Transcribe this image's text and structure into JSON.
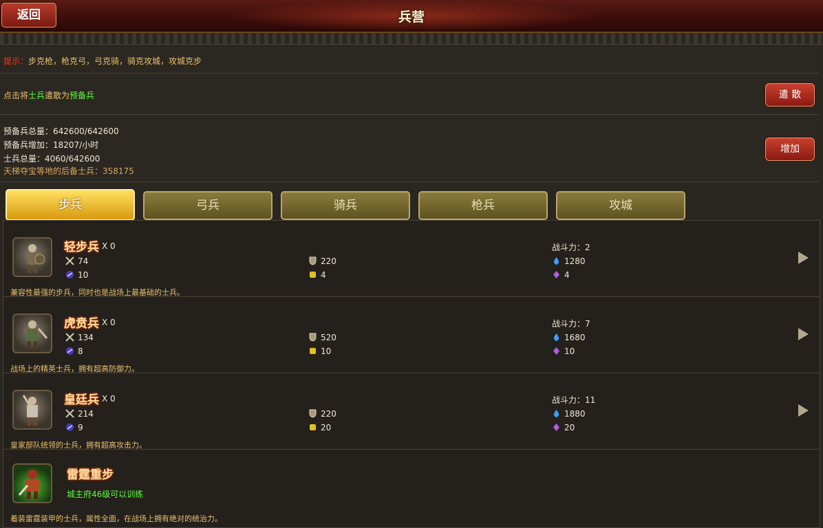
{
  "header": {
    "back_label": "返回",
    "title": "兵营"
  },
  "hint": {
    "prefix": "提示：",
    "text": "步克枪，枪克弓，弓克骑，骑克攻城，攻城克步"
  },
  "dismiss": {
    "text_a": "点击将",
    "text_b": "士兵",
    "text_c": "遣散为",
    "text_d": "预备兵",
    "button_label": "遣 散"
  },
  "stats": {
    "reserve_total": "预备兵总量：642600/642600",
    "reserve_rate": "预备兵增加：18207/小时",
    "soldier_total": "士兵总量：4060/642600",
    "backup": "天梯夺宝等地的后备士兵：358175",
    "add_label": "增加"
  },
  "tabs": [
    {
      "label": "步兵",
      "active": true
    },
    {
      "label": "弓兵",
      "active": false
    },
    {
      "label": "骑兵",
      "active": false
    },
    {
      "label": "枪兵",
      "active": false
    },
    {
      "label": "攻城",
      "active": false
    }
  ],
  "units": [
    {
      "name": "轻步兵",
      "count": "X 0",
      "power": "战斗力：2",
      "attack": "74",
      "defense": "220",
      "hp": "1280",
      "speed": "10",
      "cost": "4",
      "upkeep": "4",
      "desc": "兼容性最强的步兵，同时也是战场上最基础的士兵。"
    },
    {
      "name": "虎贲兵",
      "count": "X 0",
      "power": "战斗力：7",
      "attack": "134",
      "defense": "520",
      "hp": "1680",
      "speed": "8",
      "cost": "10",
      "upkeep": "10",
      "desc": "战场上的精英士兵，拥有超高防御力。"
    },
    {
      "name": "皇廷兵",
      "count": "X 0",
      "power": "战斗力：11",
      "attack": "214",
      "defense": "220",
      "hp": "1880",
      "speed": "9",
      "cost": "20",
      "upkeep": "20",
      "desc": "皇家部队统领的士兵，拥有超高攻击力。"
    }
  ],
  "locked_unit": {
    "name": "雷霆重步",
    "requirement": "城主府46级可以训练",
    "desc": "着装雷霆装甲的士兵，属性全面，在战场上拥有绝对的统治力。"
  },
  "colors": {
    "accent_red": "#ff3020",
    "highlight_green": "#5cff40",
    "gold_text": "#e8c070",
    "tab_active": "#ffd040"
  }
}
